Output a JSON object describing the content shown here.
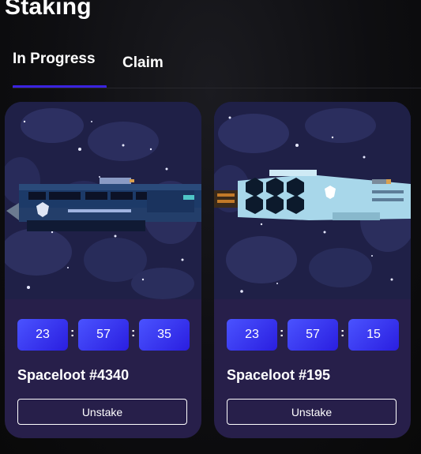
{
  "page": {
    "title": "Staking"
  },
  "tabs": [
    {
      "label": "In Progress",
      "active": true
    },
    {
      "label": "Claim",
      "active": false
    }
  ],
  "cards": [
    {
      "name": "Spaceloot #4340",
      "timer": {
        "hours": "23",
        "minutes": "57",
        "seconds": "35"
      },
      "separator": ":",
      "action_label": "Unstake",
      "ship_color": "dark-navy"
    },
    {
      "name": "Spaceloot #195",
      "timer": {
        "hours": "23",
        "minutes": "57",
        "seconds": "15"
      },
      "separator": ":",
      "action_label": "Unstake",
      "ship_color": "light-blue"
    }
  ],
  "colors": {
    "accent": "#3a23e0",
    "card_bg": "#271f4a",
    "timer_gradient_start": "#4a53ff",
    "timer_gradient_end": "#2a1ee0",
    "space_bg": "#1e2046"
  }
}
